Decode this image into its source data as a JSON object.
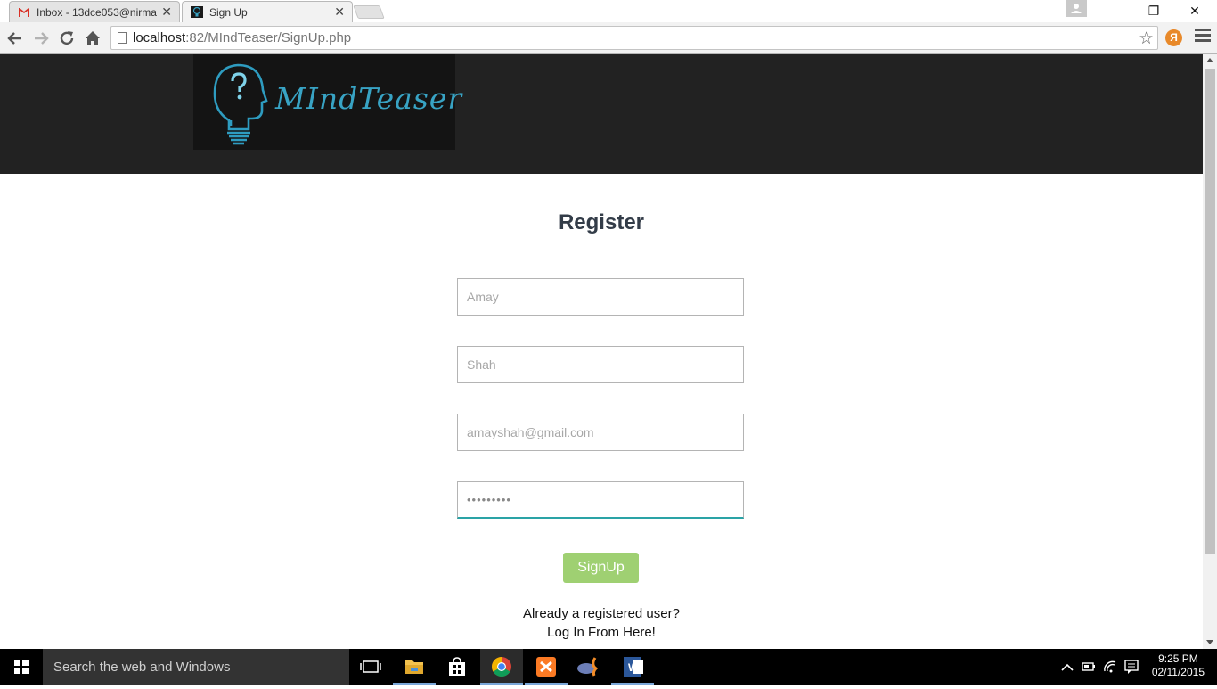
{
  "browser": {
    "tabs": [
      {
        "title": "Inbox - 13dce053@nirma",
        "active": false,
        "icon": "gmail-icon"
      },
      {
        "title": "Sign Up",
        "active": true,
        "icon": "site-favicon"
      }
    ],
    "url_host": "localhost",
    "url_path": ":82/MIndTeaser/SignUp.php",
    "window_controls": {
      "minimize": "—",
      "restore": "❐",
      "close": "✕"
    }
  },
  "site": {
    "logo_text": "MIndTeaser",
    "colors": {
      "header_bg": "#222222",
      "logo_accent": "#38a3c4",
      "signup_button": "#9fd072",
      "focus_border": "#2aa3a6"
    }
  },
  "form": {
    "title": "Register",
    "first_name": {
      "placeholder": "Amay"
    },
    "last_name": {
      "placeholder": "Shah"
    },
    "email": {
      "placeholder": "amayshah@gmail.com"
    },
    "password": {
      "value": "•••••••••"
    },
    "submit_label": "SignUp",
    "login_prompt": "Already a registered user?",
    "login_link": "Log In From Here!"
  },
  "taskbar": {
    "search_placeholder": "Search the web and Windows",
    "pinned": [
      "task-view-icon",
      "file-explorer-icon",
      "store-icon",
      "chrome-icon",
      "xampp-icon",
      "php-icon",
      "word-icon"
    ],
    "clock_time": "9:25 PM",
    "clock_date": "02/11/2015"
  }
}
